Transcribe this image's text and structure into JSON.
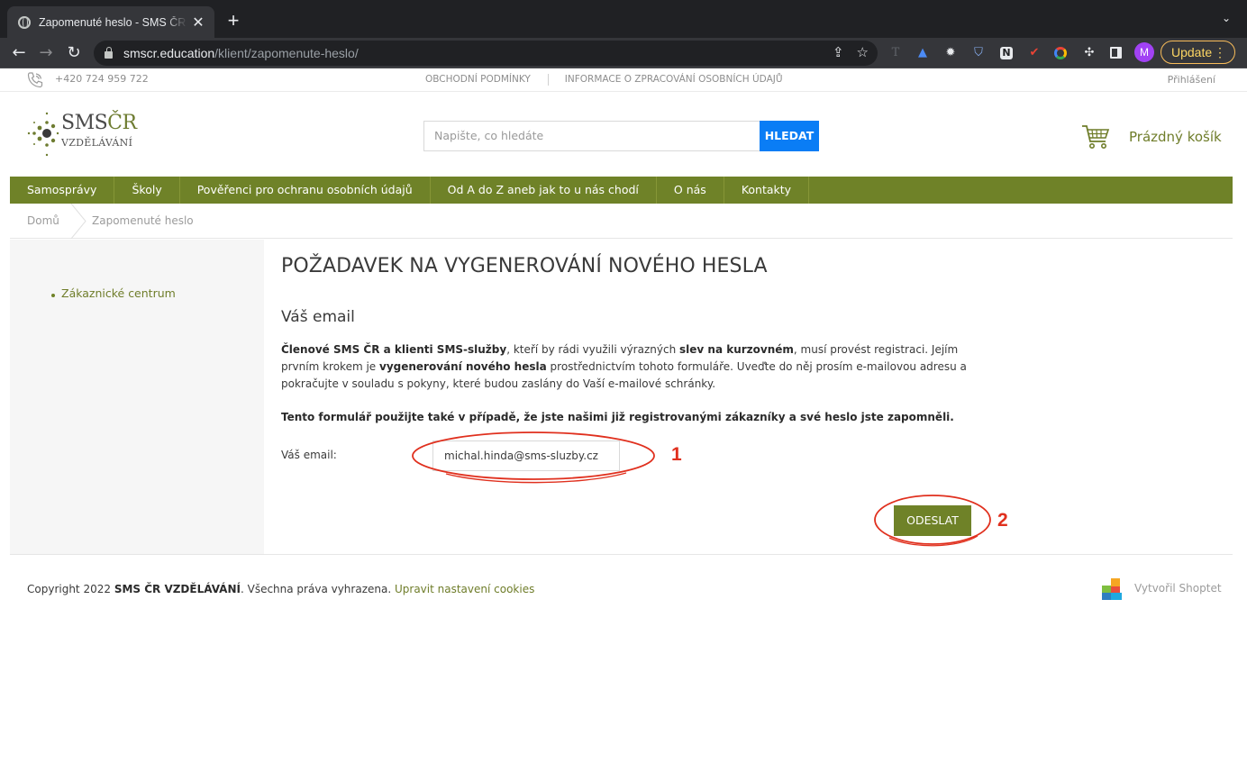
{
  "browser": {
    "tab_title": "Zapomenuté heslo - SMS ČR VZDĚLÁVÁNÍ",
    "tab_close": "✕",
    "new_tab": "+",
    "url_host": "smscr.education",
    "url_path": "/klient/zapomenute-heslo/",
    "avatar_letter": "M",
    "update_label": "Update"
  },
  "topbar": {
    "phone": "+420 724 959 722",
    "links": [
      "OBCHODNÍ PODMÍNKY",
      "INFORMACE O ZPRACOVÁNÍ OSOBNÍCH ÚDAJŮ"
    ],
    "login": "Přihlášení"
  },
  "logo": {
    "line1_a": "SMS",
    "line1_b": "ČR",
    "line2": "VZDĚLÁVÁNÍ"
  },
  "search": {
    "placeholder": "Napište, co hledáte",
    "button": "HLEDAT"
  },
  "cart": {
    "label": "Prázdný košík"
  },
  "nav": {
    "items": [
      "Samosprávy",
      "Školy",
      "Pověřenci pro ochranu osobních údajů",
      "Od A do Z aneb jak to u nás chodí",
      "O nás",
      "Kontakty"
    ]
  },
  "breadcrumb": {
    "home": "Domů",
    "current": "Zapomenuté heslo"
  },
  "sidebar": {
    "link": "Zákaznické centrum"
  },
  "form": {
    "title": "POŽADAVEK NA VYGENEROVÁNÍ NOVÉHO HESLA",
    "section": "Váš email",
    "para_b1": "Členové SMS ČR a klienti SMS-služby",
    "para_t1": ", kteří by rádi využili výrazných ",
    "para_b2": "slev na kurzovném",
    "para_t2": ", musí provést registraci. Jejím prvním krokem je ",
    "para_b3": "vygenerování nového hesla",
    "para_t3": " prostřednictvím tohoto formuláře. Uveďte do něj prosím e-mailovou adresu a pokračujte v souladu s pokyny, které budou zaslány do Vaší e-mailové schránky.",
    "para2": "Tento formulář použijte také v případě, že jste našimi již registrovanými zákazníky a své heslo jste zapomněli.",
    "email_label": "Váš email:",
    "email_value": "michal.hinda@sms-sluzby.cz",
    "submit": "ODESLAT"
  },
  "annotations": {
    "one": "1",
    "two": "2",
    "color": "#e0301e"
  },
  "footer": {
    "copyright_t1": "Copyright 2022 ",
    "copyright_b": "SMS ČR VZDĚLÁVÁNÍ",
    "copyright_t2": ". Všechna práva vyhrazena. ",
    "cookies_link": "Upravit nastavení cookies",
    "shoptet": "Vytvořil Shoptet"
  },
  "colors": {
    "brand_green": "#6f8228",
    "search_blue": "#0a7df5"
  }
}
